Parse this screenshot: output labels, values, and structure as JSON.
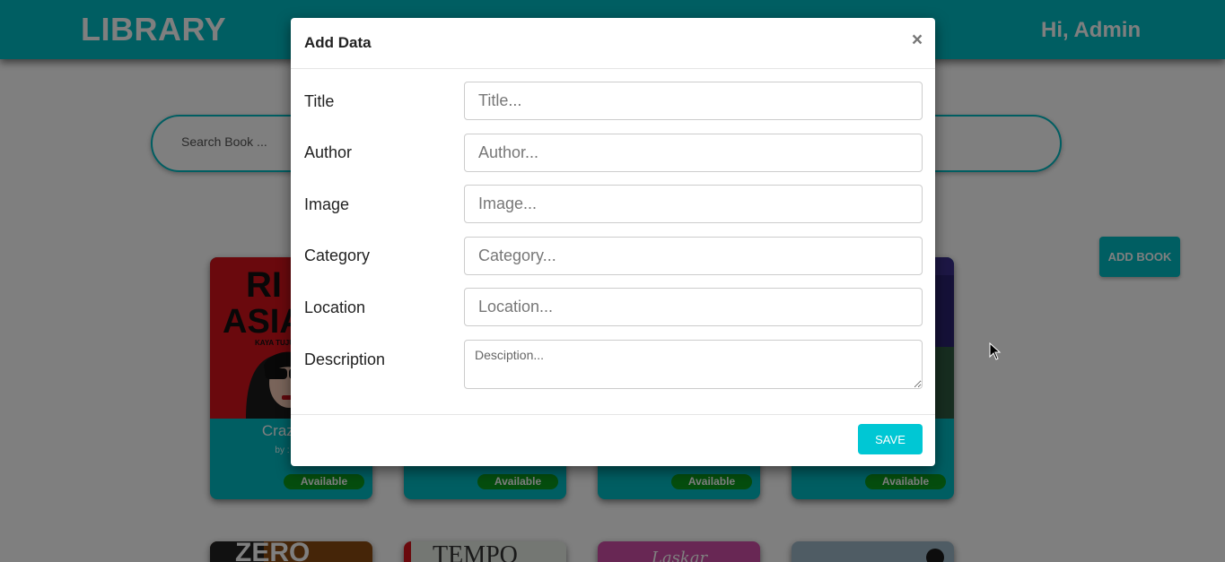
{
  "navbar": {
    "brand": "LIBRARY",
    "greeting": "Hi, Admin"
  },
  "search": {
    "placeholder": "Search Book ..."
  },
  "add_book_label": "ADD BOOK",
  "books": [
    {
      "title": "Crazy Ri",
      "author": "by : Kev",
      "status": "Available"
    },
    {
      "title": "",
      "author": "",
      "status": "Available"
    },
    {
      "title": "",
      "author": "",
      "status": "Available"
    },
    {
      "title": "",
      "author": "",
      "status": "Available"
    }
  ],
  "cover1_text": {
    "line1": "RI",
    "line2": "ASIA",
    "author_line": "KAYA TUJU"
  },
  "bottom_covers": {
    "c1": "ZERO",
    "c2": "TEMPO",
    "c3": "Laskar"
  },
  "modal": {
    "title": "Add Data",
    "close_symbol": "×",
    "fields": {
      "title": {
        "label": "Title",
        "placeholder": "Title..."
      },
      "author": {
        "label": "Author",
        "placeholder": "Author..."
      },
      "image": {
        "label": "Image",
        "placeholder": "Image..."
      },
      "category": {
        "label": "Category",
        "placeholder": "Category..."
      },
      "location": {
        "label": "Location",
        "placeholder": "Location..."
      },
      "description": {
        "label": "Description",
        "placeholder": "Desciption..."
      }
    },
    "save_label": "SAVE"
  },
  "colors": {
    "primary": "#00bcc4",
    "available": "#0a9a1c",
    "save": "#00c7d4"
  }
}
